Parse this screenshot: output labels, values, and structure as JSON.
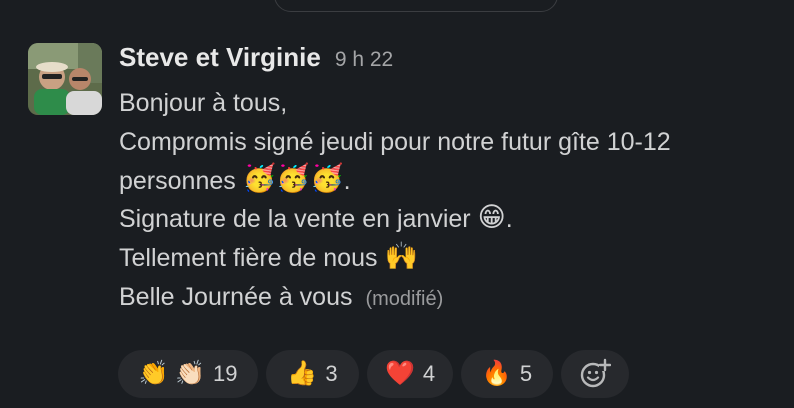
{
  "message": {
    "sender": "Steve et Virginie",
    "time": "9 h 22",
    "lines": [
      {
        "text": "Bonjour à tous,"
      },
      {
        "text": "Compromis signé jeudi pour notre futur gîte 10-12"
      },
      {
        "text": "personnes ",
        "emoji": "🥳🥳🥳",
        "suffix": "."
      },
      {
        "text": "Signature de la vente en janvier ",
        "emoji": "😁",
        "suffix": "."
      },
      {
        "text": "Tellement fière de nous ",
        "emoji": "🙌",
        "suffix": ""
      },
      {
        "text": "Belle Journée à vous ",
        "edited": "(modifié)"
      }
    ]
  },
  "reactions": [
    {
      "emoji": "👏 👏🏻",
      "count": "19"
    },
    {
      "emoji": "👍",
      "count": "3"
    },
    {
      "emoji": "❤️",
      "count": "4"
    },
    {
      "emoji": "🔥",
      "count": "5"
    }
  ],
  "add_reaction_icon": "add-emoji-icon",
  "colors": {
    "background": "#1a1d21",
    "text": "#d1d2d3",
    "reaction_bg": "#27292d",
    "muted": "#a4a5a7"
  }
}
